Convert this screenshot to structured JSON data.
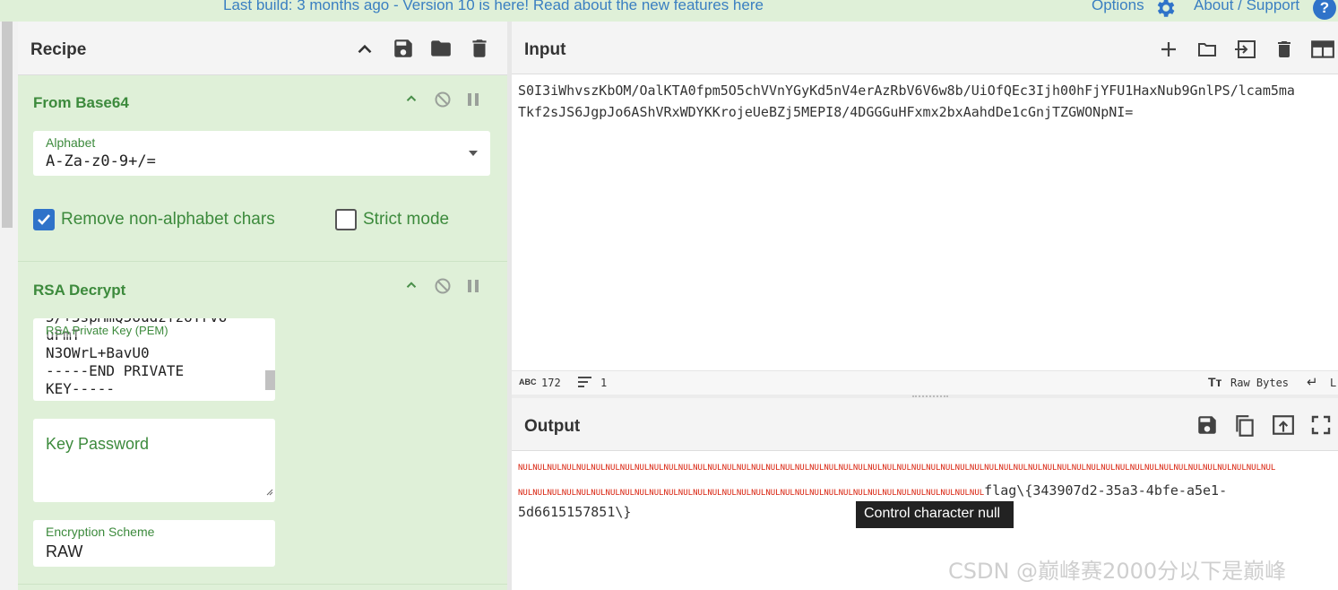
{
  "banner": {
    "text": "Last build: 3 months ago - Version 10 is here! Read about the new features here",
    "options_label": "Options",
    "about_label": "About / Support"
  },
  "recipe": {
    "title": "Recipe",
    "operations": [
      {
        "name": "From Base64",
        "alphabet_label": "Alphabet",
        "alphabet_value": "A-Za-z0-9+/=",
        "remove_non_alphabet_label": "Remove non-alphabet chars",
        "remove_non_alphabet_checked": true,
        "strict_mode_label": "Strict mode",
        "strict_mode_checked": false
      },
      {
        "name": "RSA Decrypt",
        "private_key_label": "RSA Private Key (PEM)",
        "private_key_lines": [
          "5/+3spMmQ5oudzfzoTrv6",
          "uFmT",
          "N3OWrL+BavU0",
          "-----END PRIVATE",
          "KEY-----"
        ],
        "key_password_label": "Key Password",
        "encryption_scheme_label": "Encryption Scheme",
        "encryption_scheme_value": "RAW"
      }
    ]
  },
  "input": {
    "title": "Input",
    "lines": [
      "S0I3iWhvszKbOM/OalKTA0fpm5O5chVVnYGyKd5nV4erAzRbV6V6w8b/UiOfQEc3Ijh00hFjYFU1HaxNub9GnlPS/lcam5ma",
      "Tkf2sJS6JgpJo6AShVRxWDYKKrojeUeBZj5MEPI8/4DGGGuHFxmx2bxAahdDe1cGnjTZGWONpNI="
    ],
    "status_chars_label": "ABC",
    "status_chars": "172",
    "status_lines": "1",
    "status_raw_bytes": "Raw Bytes",
    "status_eol": "L"
  },
  "output": {
    "title": "Output",
    "nul_token": "NUL",
    "nul_count_line1": 52,
    "nul_count_line2": 32,
    "flag_line1": "flag\\{343907d2-35a3-4bfe-a5e1-",
    "flag_line2": "5d6615157851\\}",
    "tooltip": "Control character null"
  },
  "watermark": "CSDN @巅峰赛2000分以下是巅峰",
  "colors": {
    "accent": "#3c8a3c",
    "banner_bg": "#dff0d8",
    "link": "#3a7fc1",
    "nul_red": "#d9230f"
  }
}
